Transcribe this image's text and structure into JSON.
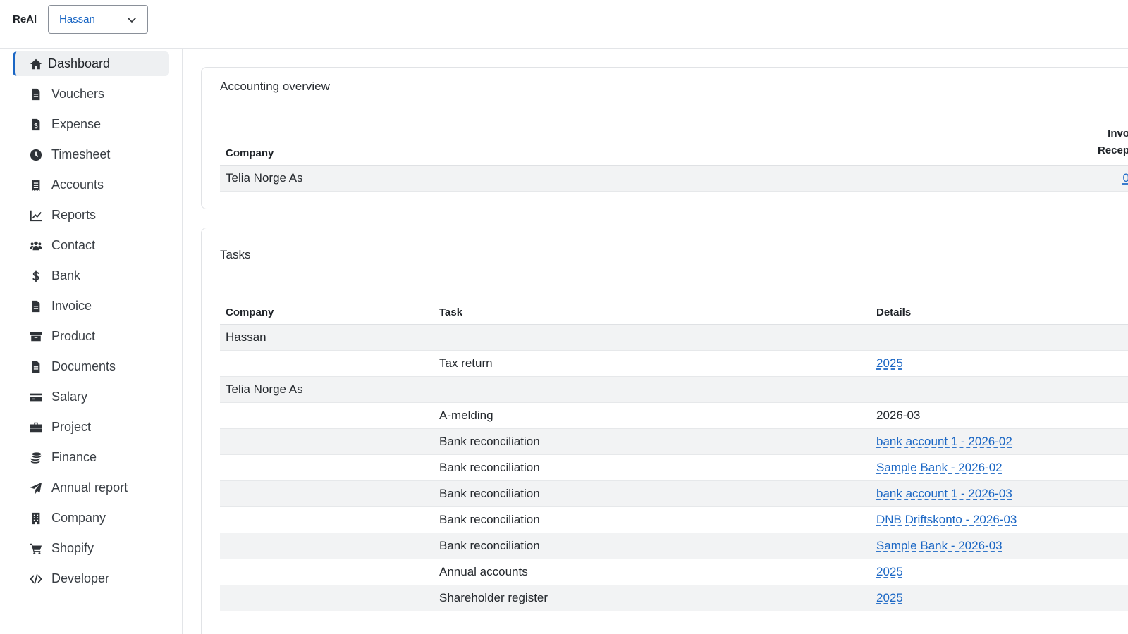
{
  "header": {
    "brand": "ReAl",
    "company_select": {
      "value": "Hassan"
    }
  },
  "sidebar": {
    "items": [
      {
        "label": "Dashboard",
        "icon": "home-icon",
        "active": true
      },
      {
        "label": "Vouchers",
        "icon": "file-icon"
      },
      {
        "label": "Expense",
        "icon": "file-invoice-dollar-icon"
      },
      {
        "label": "Timesheet",
        "icon": "clock-icon"
      },
      {
        "label": "Accounts",
        "icon": "receipt-icon"
      },
      {
        "label": "Reports",
        "icon": "line-chart-icon"
      },
      {
        "label": "Contact",
        "icon": "users-icon"
      },
      {
        "label": "Bank",
        "icon": "dollar-icon"
      },
      {
        "label": "Invoice",
        "icon": "file-lines-icon"
      },
      {
        "label": "Product",
        "icon": "archive-box-icon"
      },
      {
        "label": "Documents",
        "icon": "document-icon"
      },
      {
        "label": "Salary",
        "icon": "credit-card-icon"
      },
      {
        "label": "Project",
        "icon": "briefcase-icon"
      },
      {
        "label": "Finance",
        "icon": "coins-icon"
      },
      {
        "label": "Annual report",
        "icon": "paper-plane-icon"
      },
      {
        "label": "Company",
        "icon": "building-icon"
      },
      {
        "label": "Shopify",
        "icon": "cart-icon"
      },
      {
        "label": "Developer",
        "icon": "code-icon"
      }
    ]
  },
  "overview": {
    "title": "Accounting overview",
    "columns": {
      "company": "Company",
      "invoice_partial_1": "Invo",
      "invoice_partial_2": "Recep"
    },
    "rows": [
      {
        "company": "Telia Norge As",
        "value_partial": "0"
      }
    ]
  },
  "tasks": {
    "title": "Tasks",
    "columns": {
      "company": "Company",
      "task": "Task",
      "details": "Details"
    },
    "rows": [
      {
        "company": "Hassan",
        "task": "",
        "details": "",
        "group": true
      },
      {
        "company": "",
        "task": "Tax return",
        "details": "2025",
        "link": true
      },
      {
        "company": "Telia Norge As",
        "task": "",
        "details": "",
        "group": true
      },
      {
        "company": "",
        "task": "A-melding",
        "details": "2026-03",
        "link": false
      },
      {
        "company": "",
        "task": "Bank reconciliation",
        "details": "bank account 1 - 2026-02",
        "link": true
      },
      {
        "company": "",
        "task": "Bank reconciliation",
        "details": "Sample Bank - 2026-02",
        "link": true
      },
      {
        "company": "",
        "task": "Bank reconciliation",
        "details": "bank account 1 - 2026-03",
        "link": true
      },
      {
        "company": "",
        "task": "Bank reconciliation",
        "details": "DNB Driftskonto - 2026-03",
        "link": true
      },
      {
        "company": "",
        "task": "Bank reconciliation",
        "details": "Sample Bank - 2026-03",
        "link": true
      },
      {
        "company": "",
        "task": "Annual accounts",
        "details": "2025",
        "link": true
      },
      {
        "company": "",
        "task": "Shareholder register",
        "details": "2025",
        "link": true
      }
    ]
  },
  "colors": {
    "accent": "#1a66c4",
    "active_bg": "#eef0f2",
    "row_shade": "#f2f3f4"
  }
}
